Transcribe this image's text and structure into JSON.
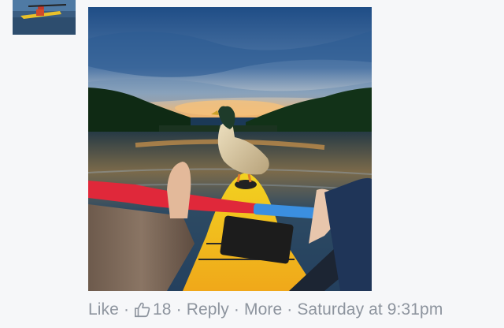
{
  "comment": {
    "actions": {
      "like_label": "Like",
      "like_count": "18",
      "reply_label": "Reply",
      "more_label": "More",
      "timestamp": "Saturday at 9:31pm",
      "separator": "·"
    },
    "photo_icon": "image-attachment",
    "like_icon": "thumbs-up-icon"
  },
  "colors": {
    "background": "#f6f7f9",
    "meta_text": "#8d949e"
  }
}
